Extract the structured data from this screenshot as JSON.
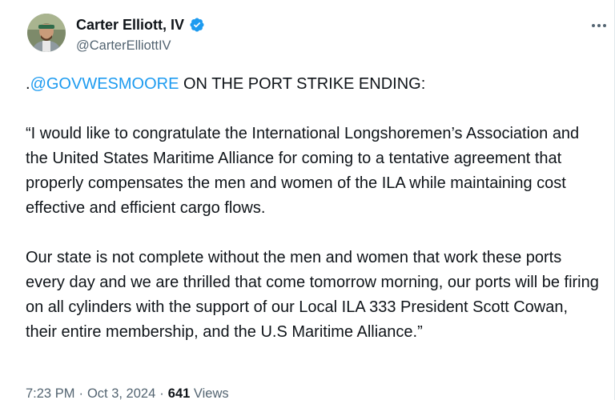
{
  "author": {
    "name": "Carter Elliott, IV",
    "handle": "@CarterElliottIV",
    "verified": true,
    "verified_color": "#1d9bf0"
  },
  "tweet": {
    "mention": "@GOVWESMOORE",
    "headline_prefix": ".",
    "headline_rest": " ON THE PORT STRIKE ENDING:",
    "paragraph_1": "“I would like to congratulate the International Longshoremen’s Association and the United States Maritime Alliance for coming to a tentative agreement that properly compensates the men and women of the ILA while maintaining cost effective and efficient cargo flows.",
    "paragraph_2": "Our state is not complete without the men and women that work these ports every day and we are thrilled that come tomorrow morning, our ports will be firing on all cylinders with the support of our Local ILA 333 President Scott Cowan, their entire membership, and the U.S Maritime Alliance.”"
  },
  "meta": {
    "time": "7:23 PM",
    "separator": "·",
    "date": "Oct 3, 2024",
    "views_count": "641",
    "views_label": "Views"
  },
  "icons": {
    "more": "more-horizontal-icon",
    "verified": "verified-badge-icon"
  },
  "colors": {
    "link": "#1d9bf0",
    "secondary_text": "#536471",
    "primary_text": "#0f1419"
  }
}
